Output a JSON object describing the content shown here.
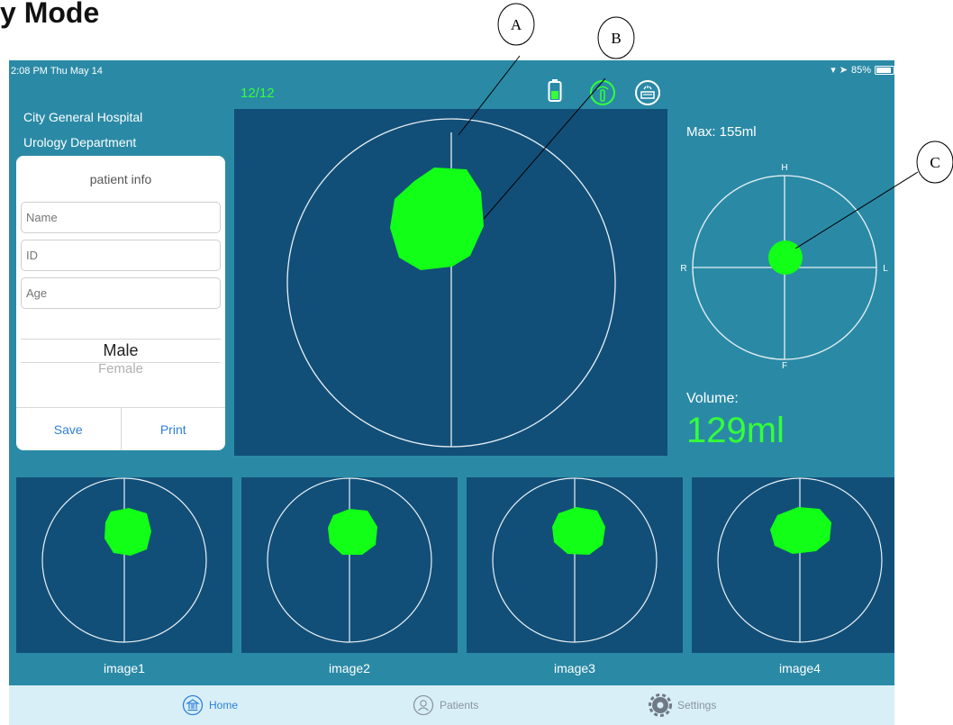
{
  "document": {
    "title": "y Mode"
  },
  "status_bar": {
    "time": "2:08 PM  Thu May 14",
    "battery": "85%"
  },
  "counter": "12/12",
  "header": {
    "hospital": "City General Hospital",
    "department": "Urology Department",
    "icons": [
      "battery-icon",
      "probe-icon",
      "scanner-icon"
    ]
  },
  "patient_card": {
    "title": "patient info",
    "name_placeholder": "Name",
    "id_placeholder": "ID",
    "age_placeholder": "Age",
    "gender_selected": "Male",
    "gender_next": "Female",
    "save_label": "Save",
    "print_label": "Print"
  },
  "orientation": {
    "top": "H",
    "bottom": "F",
    "left": "R",
    "right": "L"
  },
  "max_label": "Max: 155ml",
  "volume": {
    "label": "Volume:",
    "value": "129ml"
  },
  "thumbnails": [
    {
      "label": "image1"
    },
    {
      "label": "image2"
    },
    {
      "label": "image3"
    },
    {
      "label": "image4"
    }
  ],
  "tabs": [
    {
      "label": "Home",
      "icon": "home-icon",
      "active": true
    },
    {
      "label": "Patients",
      "icon": "patients-icon",
      "active": false
    },
    {
      "label": "Settings",
      "icon": "settings-icon",
      "active": false
    }
  ],
  "callouts": [
    "A",
    "B",
    "C"
  ],
  "colors": {
    "accent_green": "#34ff3a",
    "app_bg": "#2a8aa6",
    "panel_bg": "#124f78",
    "link_blue": "#2f7fd8"
  }
}
